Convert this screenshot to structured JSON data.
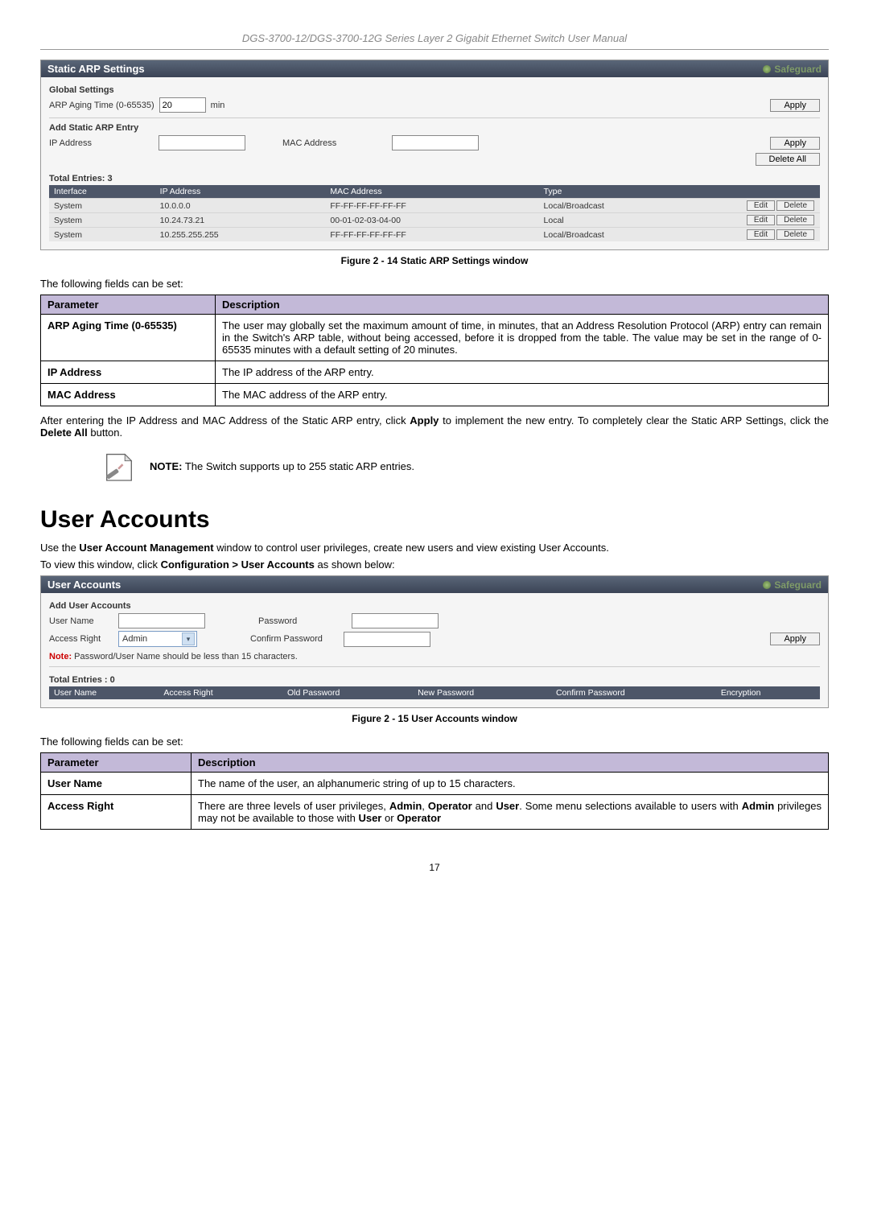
{
  "header": "DGS-3700-12/DGS-3700-12G Series Layer 2 Gigabit Ethernet Switch User Manual",
  "arp_panel": {
    "title": "Static ARP Settings",
    "safeguard": "Safeguard",
    "global_settings": "Global Settings",
    "aging_label": "ARP Aging Time (0-65535)",
    "aging_value": "20",
    "aging_unit": "min",
    "apply": "Apply",
    "add_title": "Add Static ARP Entry",
    "ip_label": "IP Address",
    "mac_label": "MAC Address",
    "delete_all": "Delete All",
    "total": "Total Entries:  3",
    "cols": [
      "Interface",
      "IP Address",
      "MAC Address",
      "Type"
    ],
    "rows": [
      {
        "if": "System",
        "ip": "10.0.0.0",
        "mac": "FF-FF-FF-FF-FF-FF",
        "type": "Local/Broadcast"
      },
      {
        "if": "System",
        "ip": "10.24.73.21",
        "mac": "00-01-02-03-04-00",
        "type": "Local"
      },
      {
        "if": "System",
        "ip": "10.255.255.255",
        "mac": "FF-FF-FF-FF-FF-FF",
        "type": "Local/Broadcast"
      }
    ],
    "edit": "Edit",
    "del": "Delete"
  },
  "fig1": "Figure 2 - 14 Static ARP Settings window",
  "lead1": "The following fields can be set:",
  "tbl_hdr_param": "Parameter",
  "tbl_hdr_desc": "Description",
  "arp_params": [
    {
      "p": "ARP Aging Time (0-65535)",
      "d": "The user may globally set the maximum amount of time, in minutes, that an Address Resolution Protocol (ARP) entry can remain in the Switch's ARP table, without being accessed, before it is dropped from the table. The value may be set in the range of 0-65535 minutes with a default setting of 20 minutes."
    },
    {
      "p": "IP Address",
      "d": "The IP address of the ARP entry."
    },
    {
      "p": "MAC Address",
      "d": "The MAC address of the ARP entry."
    }
  ],
  "after1_a": "After entering the IP Address and MAC Address of the Static ARP entry, click ",
  "after1_b": "Apply",
  "after1_c": " to implement the new entry. To completely clear the Static ARP Settings, click the ",
  "after1_d": "Delete All",
  "after1_e": " button.",
  "note_b": "NOTE:",
  "note_t": " The Switch supports up to 255 static ARP entries.",
  "h_user": "User Accounts",
  "ua_intro_a": "Use the ",
  "ua_intro_b": "User Account Management",
  "ua_intro_c": " window to control user privileges, create new users and view existing User Accounts.",
  "ua_nav_a": "To view this window, click ",
  "ua_nav_b": "Configuration > User Accounts",
  "ua_nav_c": " as shown below:",
  "ua_panel": {
    "title": "User Accounts",
    "safeguard": "Safeguard",
    "add": "Add User Accounts",
    "user": "User Name",
    "access": "Access Right",
    "access_val": "Admin",
    "pass": "Password",
    "cpass": "Confirm Password",
    "apply": "Apply",
    "note_b": "Note:",
    "note_t": " Password/User Name should be less than 15 characters.",
    "total": "Total Entries : 0",
    "cols": [
      "User Name",
      "Access Right",
      "Old Password",
      "New Password",
      "Confirm Password",
      "Encryption"
    ]
  },
  "fig2": "Figure 2 - 15 User Accounts window",
  "lead2": "The following fields can be set:",
  "ua_params": [
    {
      "p": "User Name",
      "d": "The name of the user, an alphanumeric string of up to 15 characters."
    },
    {
      "p": "Access Right",
      "d1": "There are three levels of user privileges, ",
      "b1": "Admin",
      "d2": ", ",
      "b2": "Operator",
      "d3": " and ",
      "b3": "User",
      "d4": ". Some menu selections available to users with ",
      "b4": "Admin",
      "d5": " privileges may not be available to those with ",
      "b5": "User",
      "d6": " or ",
      "b6": "Operator"
    }
  ],
  "pagenum": "17"
}
